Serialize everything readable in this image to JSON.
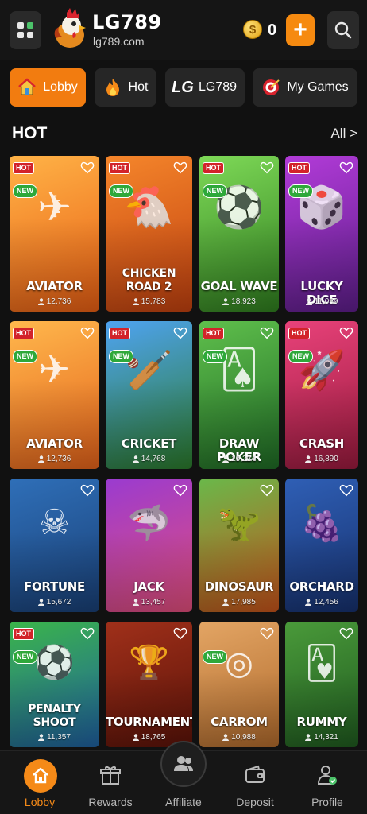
{
  "header": {
    "brand": "LG789",
    "domain": "lg789.com",
    "balance": "0",
    "add_label": "+"
  },
  "tabs": [
    {
      "label": "Lobby",
      "icon": "house-icon",
      "active": true
    },
    {
      "label": "Hot",
      "icon": "flame-icon",
      "active": false
    },
    {
      "label": "LG789",
      "icon": "lg-logo-icon",
      "active": false
    },
    {
      "label": "My Games",
      "icon": "target-icon",
      "active": false
    }
  ],
  "section": {
    "title": "HOT",
    "see_all": "All >"
  },
  "badges": {
    "hot": "HOT",
    "new": "NEW"
  },
  "games": [
    {
      "name": "AVIATOR",
      "players": "12,736",
      "hot": true,
      "new": true,
      "colors": [
        "#ffb347",
        "#e85e13"
      ]
    },
    {
      "name": "CHICKEN ROAD 2",
      "players": "15,783",
      "hot": true,
      "new": true,
      "colors": [
        "#f5862b",
        "#c1400f"
      ]
    },
    {
      "name": "GOAL WAVE",
      "players": "18,923",
      "hot": true,
      "new": true,
      "colors": [
        "#7ed957",
        "#2f7d1f"
      ]
    },
    {
      "name": "LUCKY DICE",
      "players": "11,059",
      "hot": true,
      "new": true,
      "colors": [
        "#b23bd8",
        "#5d1e8a"
      ]
    },
    {
      "name": "AVIATOR",
      "players": "12,736",
      "hot": true,
      "new": true,
      "colors": [
        "#ffb84d",
        "#e4621a"
      ]
    },
    {
      "name": "CRICKET",
      "players": "14,768",
      "hot": true,
      "new": true,
      "colors": [
        "#4fa3f2",
        "#2b7a2a"
      ]
    },
    {
      "name": "DRAW POKER",
      "players": "10,234",
      "hot": true,
      "new": true,
      "colors": [
        "#5fbf4c",
        "#1f6a25"
      ]
    },
    {
      "name": "CRASH",
      "players": "16,890",
      "hot": true,
      "new": true,
      "colors": [
        "#e8427a",
        "#9a1a3d"
      ]
    },
    {
      "name": "FORTUNE",
      "players": "15,672",
      "hot": false,
      "new": false,
      "colors": [
        "#2f6fb8",
        "#193f75"
      ]
    },
    {
      "name": "JACK",
      "players": "13,457",
      "hot": false,
      "new": false,
      "colors": [
        "#9a3bd0",
        "#e24e7a"
      ]
    },
    {
      "name": "DINOSAUR",
      "players": "17,985",
      "hot": false,
      "new": false,
      "colors": [
        "#6ab84a",
        "#c5521a"
      ]
    },
    {
      "name": "ORCHARD",
      "players": "12,456",
      "hot": false,
      "new": false,
      "colors": [
        "#2f5fb5",
        "#16306d"
      ]
    },
    {
      "name": "PENALTY SHOOT",
      "players": "11,357",
      "hot": true,
      "new": true,
      "colors": [
        "#3bb54a",
        "#1f5fa0"
      ]
    },
    {
      "name": "TOURNAMENT",
      "players": "18,765",
      "hot": false,
      "new": false,
      "colors": [
        "#a0301a",
        "#5a1208"
      ]
    },
    {
      "name": "CARROM",
      "players": "10,988",
      "hot": false,
      "new": true,
      "colors": [
        "#e3a564",
        "#b06a2c"
      ]
    },
    {
      "name": "RUMMY",
      "players": "14,321",
      "hot": false,
      "new": false,
      "colors": [
        "#4a9a3a",
        "#1f5a1f"
      ]
    }
  ],
  "nav": [
    {
      "label": "Lobby",
      "icon": "house-icon",
      "active": true
    },
    {
      "label": "Rewards",
      "icon": "gift-icon",
      "active": false
    },
    {
      "label": "Affiliate",
      "icon": "users-icon",
      "active": false
    },
    {
      "label": "Deposit",
      "icon": "wallet-icon",
      "active": false
    },
    {
      "label": "Profile",
      "icon": "profile-icon",
      "active": false
    }
  ],
  "colors": {
    "accent": "#f27c10",
    "hot": "#d2232a",
    "new": "#2ea83a",
    "background": "#111111"
  }
}
